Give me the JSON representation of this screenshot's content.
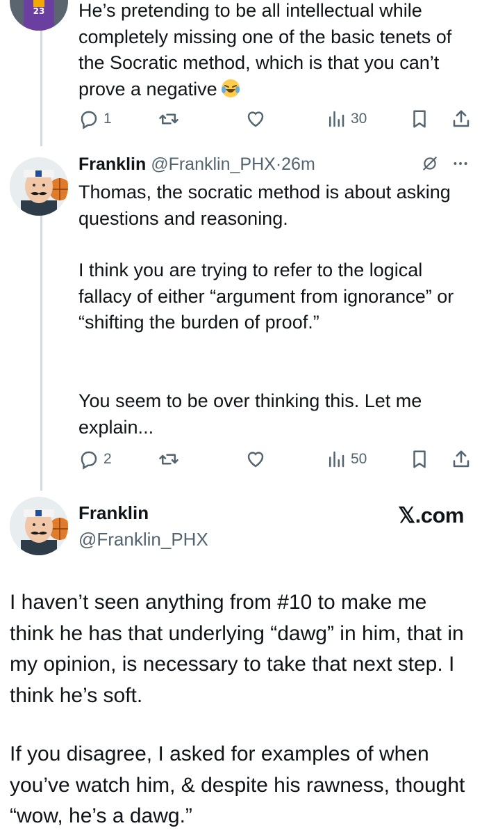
{
  "tweet_prev": {
    "text": "He’s pretending to be all intellectual while completely missing one of the basic tenets of the Socratic method, which is that you can’t prove a negative",
    "emoji": "😂",
    "avatar_jersey_number": "23",
    "replies": "1",
    "views": "30"
  },
  "tweet_reply": {
    "name": "Franklin",
    "handle": "@Franklin_PHX",
    "separator": "·",
    "time": "26m",
    "paragraph1": "Thomas, the socratic method is about asking questions and reasoning.",
    "paragraph2": "I think you are trying to refer to the logical fallacy of either “argument from ignorance” or “shifting the burden of proof.”",
    "paragraph3": "You seem to be over thinking this. Let me explain...",
    "replies": "2",
    "views": "50"
  },
  "card": {
    "name": "Franklin",
    "handle": "@Franklin_PHX",
    "brand": "𝕏.com",
    "paragraph1": "I haven’t seen anything from #10 to make me think he has that underlying “dawg” in him, that in my opinion, is necessary to take that next step. I think he’s soft.",
    "paragraph2": "If you disagree, I asked for examples of when you’ve watch him, & despite his rawness, thought “wow, he’s a dawg.”"
  },
  "icons": {
    "reply": "reply-icon",
    "retweet": "retweet-icon",
    "like": "heart-icon",
    "views": "views-chart-icon",
    "bookmark": "bookmark-icon",
    "share": "share-icon",
    "grok": "grok-icon",
    "more": "more-dots-icon"
  },
  "colors": {
    "text": "#0f1419",
    "secondary": "#536471",
    "thread_line": "#cfd9de"
  }
}
